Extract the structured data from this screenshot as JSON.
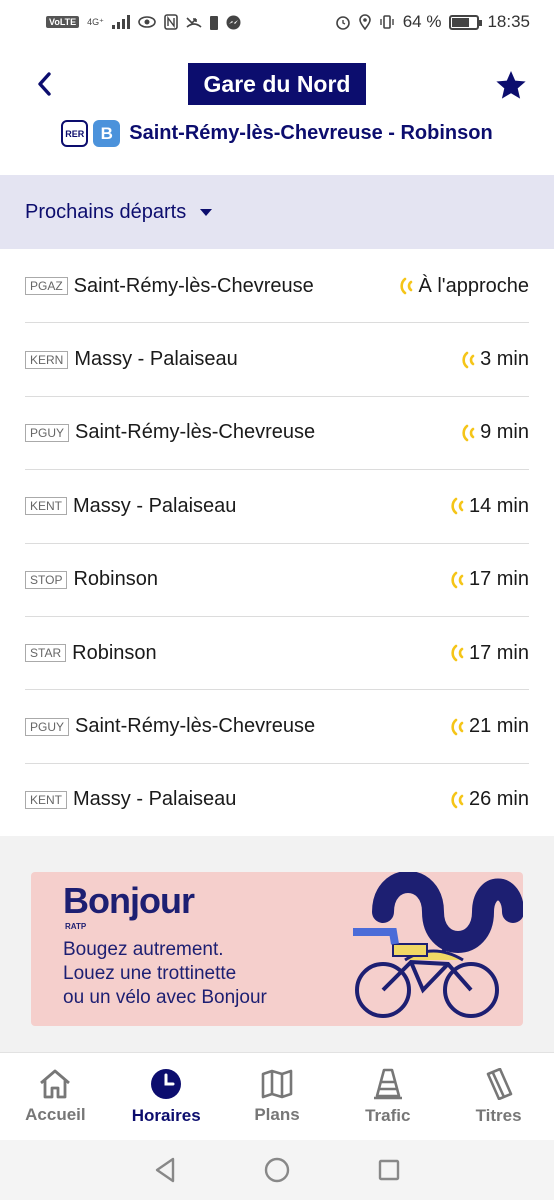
{
  "status_bar": {
    "network_badge": "VoLTE",
    "signal_label": "4G⁺",
    "battery_percent": "64 %",
    "battery_level": 0.64,
    "time": "18:35"
  },
  "header": {
    "title": "Gare du Nord",
    "back_icon": "chevron-left-icon",
    "favorite_icon": "star-icon",
    "mode_badge": "RER",
    "line_badge": "B",
    "line_color": "#4b92db",
    "direction": "Saint-Rémy-lès-Chevreuse - Robinson"
  },
  "section": {
    "label": "Prochains départs"
  },
  "departures": [
    {
      "code": "PGAZ",
      "destination": "Saint-Rémy-lès-Chevreuse",
      "time": "À l'approche"
    },
    {
      "code": "KERN",
      "destination": "Massy - Palaiseau",
      "time": "3 min"
    },
    {
      "code": "PGUY",
      "destination": "Saint-Rémy-lès-Chevreuse",
      "time": "9 min"
    },
    {
      "code": "KENT",
      "destination": "Massy - Palaiseau",
      "time": "14 min"
    },
    {
      "code": "STOP",
      "destination": "Robinson",
      "time": "17 min"
    },
    {
      "code": "STAR",
      "destination": "Robinson",
      "time": "17 min"
    },
    {
      "code": "PGUY",
      "destination": "Saint-Rémy-lès-Chevreuse",
      "time": "21 min"
    },
    {
      "code": "KENT",
      "destination": "Massy - Palaiseau",
      "time": "26 min"
    }
  ],
  "ad": {
    "brand": "Bonjour",
    "brand_sub": "RATP",
    "line1": "Bougez autrement.",
    "line2": "Louez une trottinette",
    "line3": "ou un vélo avec Bonjour"
  },
  "bottom_nav": [
    {
      "label": "Accueil",
      "icon": "home-icon",
      "active": false
    },
    {
      "label": "Horaires",
      "icon": "clock-icon",
      "active": true
    },
    {
      "label": "Plans",
      "icon": "map-icon",
      "active": false
    },
    {
      "label": "Trafic",
      "icon": "traffic-cone-icon",
      "active": false
    },
    {
      "label": "Titres",
      "icon": "ticket-icon",
      "active": false
    }
  ],
  "colors": {
    "brand_navy": "#0c0d6e",
    "realtime_yellow": "#f5c518",
    "section_bg": "#e4e4f2"
  }
}
